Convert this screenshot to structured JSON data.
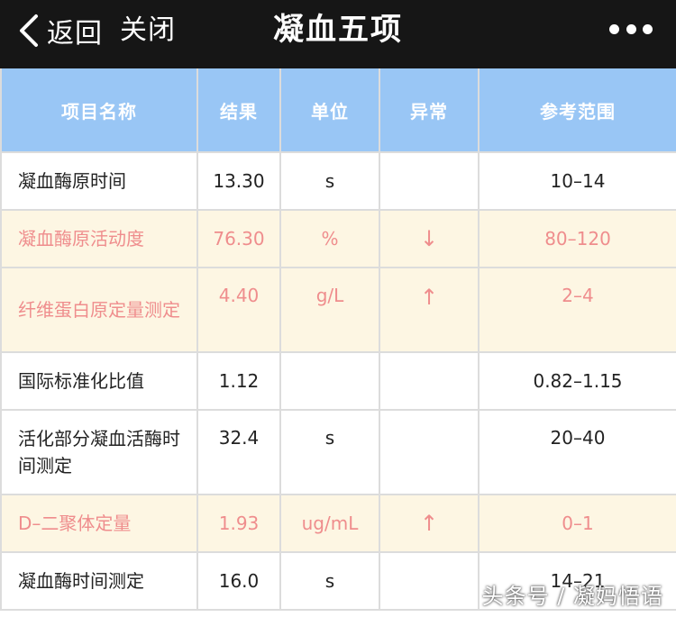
{
  "nav": {
    "back_label": "返回",
    "close_label": "关闭",
    "title": "凝血五项"
  },
  "table": {
    "headers": [
      "项目名称",
      "结果",
      "单位",
      "异常",
      "参考范围"
    ],
    "rows": [
      {
        "name": "凝血酶原时间",
        "result": "13.30",
        "unit": "s",
        "flag": "",
        "range": "10–14",
        "abnormal": false
      },
      {
        "name": "凝血酶原活动度",
        "result": "76.30",
        "unit": "%",
        "flag": "↓",
        "range": "80–120",
        "abnormal": true
      },
      {
        "name": "纤维蛋白原定量测定",
        "result": "4.40",
        "unit": "g/L",
        "flag": "↑",
        "range": "2–4",
        "abnormal": true
      },
      {
        "name": "国际标准化比值",
        "result": "1.12",
        "unit": "",
        "flag": "",
        "range": "0.82–1.15",
        "abnormal": false
      },
      {
        "name": "活化部分凝血活酶时间测定",
        "result": "32.4",
        "unit": "s",
        "flag": "",
        "range": "20–40",
        "abnormal": false
      },
      {
        "name": "D–二聚体定量",
        "result": "1.93",
        "unit": "ug/mL",
        "flag": "↑",
        "range": "0–1",
        "abnormal": true
      },
      {
        "name": "凝血酶时间测定",
        "result": "16.0",
        "unit": "s",
        "flag": "",
        "range": "14–21",
        "abnormal": false
      }
    ]
  },
  "watermark": "头条号 / 凝妈悟语",
  "icons": {
    "back": "chevron-left-icon",
    "more": "more-dots-icon"
  },
  "colors": {
    "header_bg": "#99c6f5",
    "abnormal_bg": "#fdf6e3",
    "abnormal_text": "#ef8d8d",
    "navbar_bg": "#161616"
  }
}
